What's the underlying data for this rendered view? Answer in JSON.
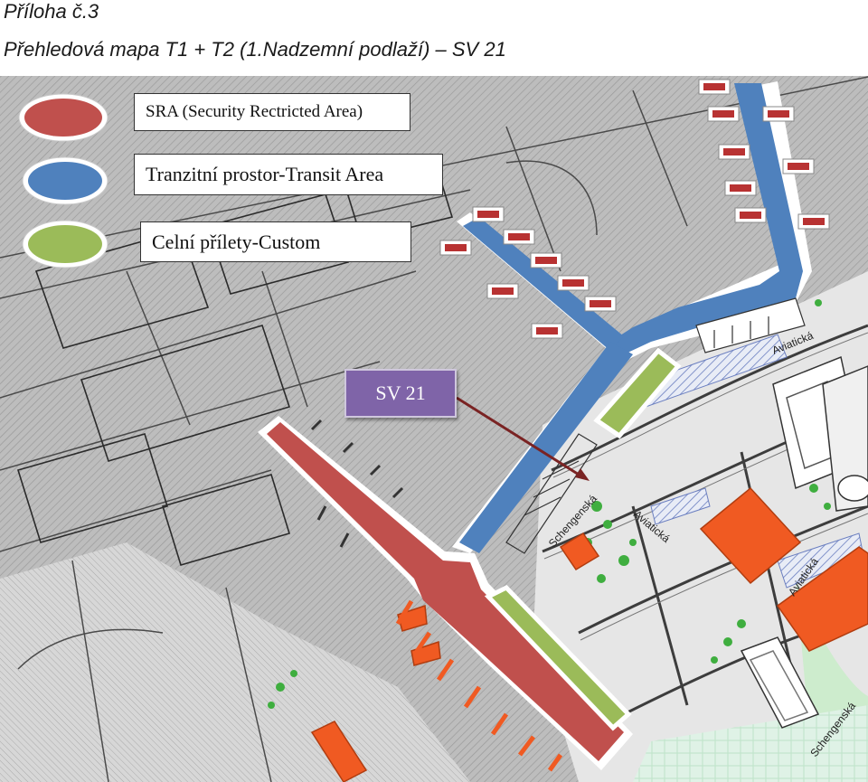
{
  "header": {
    "annex": "Příloha č.3",
    "title": "Přehledová mapa T1 + T2 (1.Nadzemní podlaží) – SV 21"
  },
  "legend": [
    {
      "label": "SRA (Security Rectricted Area)",
      "color": "#c0504d"
    },
    {
      "label": "Tranzitní prostor-Transit Area",
      "color": "#4f81bd"
    },
    {
      "label": "Celní přílety-Custom",
      "color": "#9bbb59"
    }
  ],
  "marker": {
    "label": "SV 21",
    "color": "#7f64a8"
  },
  "streets": [
    "Aviatická",
    "Schengenská",
    "Aviatická",
    "Aviatická",
    "Schengenská"
  ],
  "colors": {
    "sra": "#c0504d",
    "transit": "#4f81bd",
    "custom": "#9bbb59",
    "building": "#f05a22",
    "greenery": "#2aa02a",
    "gate": "#b83232",
    "ground": "#b9b9b9"
  }
}
